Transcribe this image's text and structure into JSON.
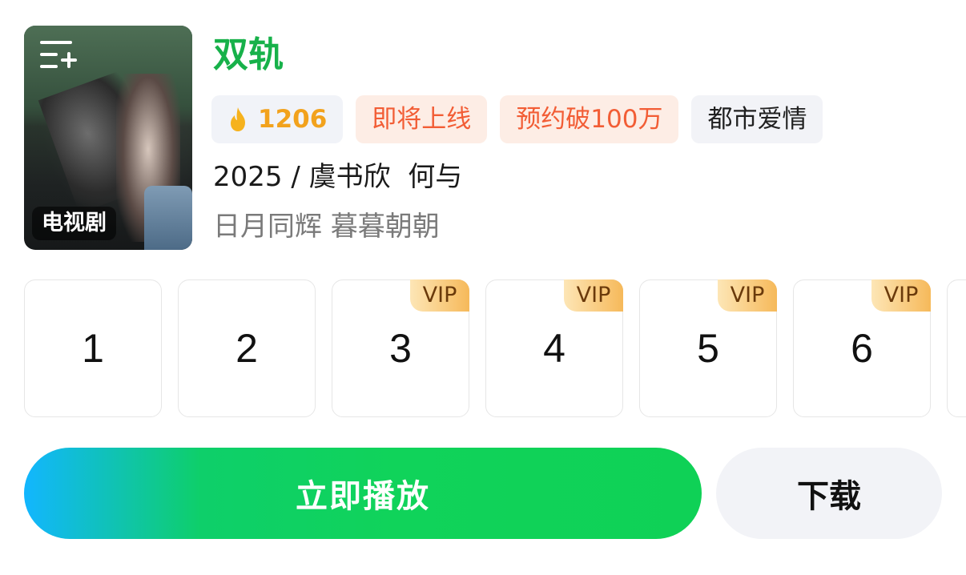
{
  "poster": {
    "type_badge": "电视剧",
    "icon": "playlist-add-icon"
  },
  "title": "双轨",
  "tags": {
    "heat_value": "1206",
    "heat_icon": "flame-icon",
    "status": "即将上线",
    "reservation": "预约破100万",
    "genre": "都市爱情"
  },
  "meta": {
    "line1": "2025 / 虞书欣  何与",
    "line2": "日月同辉 暮暮朝朝"
  },
  "episodes": [
    {
      "num": "1",
      "vip": ""
    },
    {
      "num": "2",
      "vip": ""
    },
    {
      "num": "3",
      "vip": "VIP"
    },
    {
      "num": "4",
      "vip": "VIP"
    },
    {
      "num": "5",
      "vip": "VIP"
    },
    {
      "num": "6",
      "vip": "VIP"
    }
  ],
  "buttons": {
    "play": "立即播放",
    "download": "下载"
  },
  "colors": {
    "title_green": "#17b14a",
    "heat_orange": "#f2a21d",
    "tag_red": "#f25d35",
    "play_gradient_start": "#12b6ff",
    "play_gradient_end": "#0fd156"
  }
}
